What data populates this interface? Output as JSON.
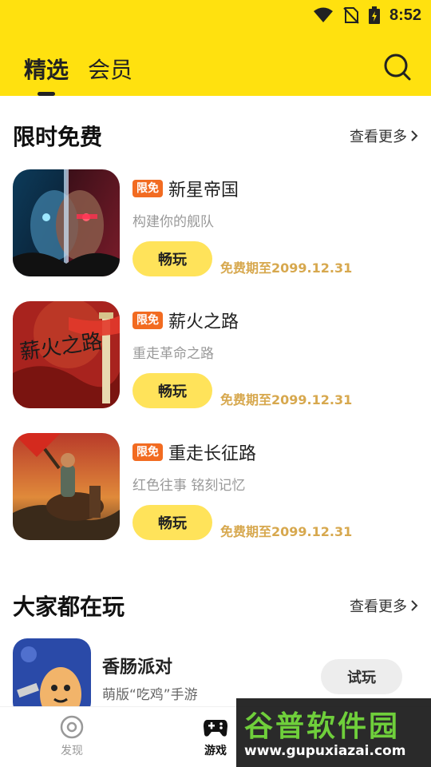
{
  "status_bar": {
    "time": "8:52"
  },
  "top_tabs": [
    {
      "label": "精选",
      "active": true
    },
    {
      "label": "会员",
      "active": false
    }
  ],
  "search": {
    "icon": "search-icon"
  },
  "limited_free": {
    "title": "限时免费",
    "more_label": "查看更多",
    "games": [
      {
        "name": "新星帝国",
        "badge": "限免",
        "desc": "构建你的舰队",
        "play_label": "畅玩",
        "free_until": "免费期至2099.12.31"
      },
      {
        "name": "薪火之路",
        "badge": "限免",
        "desc": "重走革命之路",
        "play_label": "畅玩",
        "free_until": "免费期至2099.12.31"
      },
      {
        "name": "重走长征路",
        "badge": "限免",
        "desc": "红色往事 铭刻记忆",
        "play_label": "畅玩",
        "free_until": "免费期至2099.12.31"
      }
    ],
    "thumb2_text": "薪火之路"
  },
  "popular": {
    "title": "大家都在玩",
    "more_label": "查看更多",
    "games": [
      {
        "name": "香肠派对",
        "desc": "萌版“吃鸡”手游",
        "try_label": "试玩"
      }
    ]
  },
  "bottom_nav": [
    {
      "label": "发现",
      "icon": "discover-icon",
      "active": false
    },
    {
      "label": "游戏",
      "icon": "gamepad-icon",
      "active": true
    }
  ],
  "watermark": {
    "title": "谷普软件园",
    "url": "www.gupuxiazai.com"
  },
  "colors": {
    "accent": "#FFE10F",
    "badge": "#F26B21",
    "free_text": "#D7A84E",
    "play_button": "#FFE35A"
  }
}
